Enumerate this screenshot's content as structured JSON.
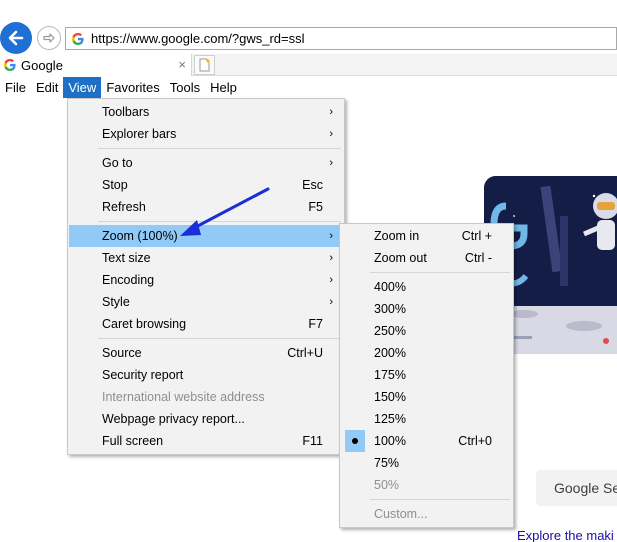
{
  "address_bar": {
    "url": "https://www.google.com/?gws_rd=ssl"
  },
  "tab": {
    "title": "Google",
    "close_glyph": "×"
  },
  "menu_bar": {
    "items": [
      "File",
      "Edit",
      "View",
      "Favorites",
      "Tools",
      "Help"
    ],
    "active": "View"
  },
  "view_menu": {
    "items": [
      {
        "label": "Toolbars",
        "submenu": true
      },
      {
        "label": "Explorer bars",
        "submenu": true
      },
      {
        "label": "Go to",
        "submenu": true
      },
      {
        "label": "Stop",
        "shortcut": "Esc"
      },
      {
        "label": "Refresh",
        "shortcut": "F5"
      },
      {
        "label": "Zoom (100%)",
        "submenu": true,
        "highlighted": true
      },
      {
        "label": "Text size",
        "submenu": true
      },
      {
        "label": "Encoding",
        "submenu": true
      },
      {
        "label": "Style",
        "submenu": true
      },
      {
        "label": "Caret browsing",
        "shortcut": "F7"
      },
      {
        "label": "Source",
        "shortcut": "Ctrl+U"
      },
      {
        "label": "Security report"
      },
      {
        "label": "International website address",
        "disabled": true
      },
      {
        "label": "Webpage privacy report..."
      },
      {
        "label": "Full screen",
        "shortcut": "F11"
      }
    ],
    "submenu_glyph": "›"
  },
  "zoom_menu": {
    "items": [
      {
        "label": "Zoom in",
        "shortcut": "Ctrl +"
      },
      {
        "label": "Zoom out",
        "shortcut": "Ctrl -"
      },
      {
        "label": "400%"
      },
      {
        "label": "300%"
      },
      {
        "label": "250%"
      },
      {
        "label": "200%"
      },
      {
        "label": "175%"
      },
      {
        "label": "150%"
      },
      {
        "label": "125%"
      },
      {
        "label": "100%",
        "shortcut": "Ctrl+0",
        "checked": true
      },
      {
        "label": "75%"
      },
      {
        "label": "50%",
        "disabled": true
      },
      {
        "label": "Custom...",
        "disabled": true
      }
    ]
  },
  "page": {
    "search_button": "Google Se",
    "explore_link": "Explore the maki"
  },
  "colors": {
    "accent": "#1e70c6",
    "highlight": "#91c9f7",
    "annotation_arrow": "#1a2fd6",
    "link": "#1a0dab"
  }
}
